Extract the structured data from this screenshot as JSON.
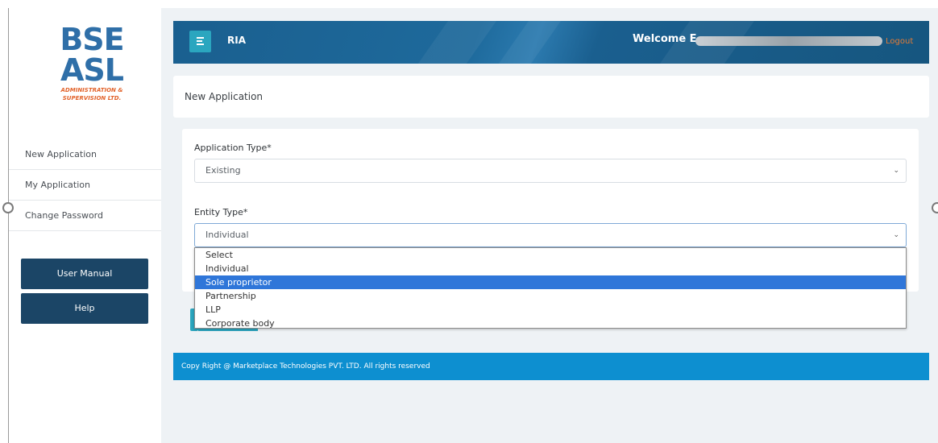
{
  "logo": {
    "line1": "BSE",
    "line2": "ASL",
    "subtitle_line1": "ADMINISTRATION &",
    "subtitle_line2": "SUPERVISION LTD."
  },
  "sidebar": {
    "items": [
      {
        "label": "New Application"
      },
      {
        "label": "My Application"
      },
      {
        "label": "Change Password"
      }
    ],
    "user_manual_label": "User Manual",
    "help_label": "Help"
  },
  "header": {
    "title": "RIA",
    "welcome": "Welcome E",
    "logout_label": "Logout"
  },
  "page": {
    "title": "New Application"
  },
  "form": {
    "application_type_label": "Application Type*",
    "application_type_value": "Existing",
    "entity_type_label": "Entity Type*",
    "entity_type_value": "Individual",
    "entity_options": [
      "Select",
      "Individual",
      "Sole proprietor",
      "Partnership",
      "LLP",
      "Corporate body"
    ],
    "highlighted_option": "Sole proprietor"
  },
  "footer": {
    "text": "Copy Right @ Marketplace Technologies PVT. LTD. All rights reserved"
  },
  "colors": {
    "brand_blue": "#2f6fa8",
    "brand_orange": "#e2632b",
    "header_bg": "#1a5f8f",
    "sidebar_button": "#1b4566",
    "accent_teal": "#2ba6bf",
    "footer_bg": "#0d8fd0",
    "option_highlight": "#2f76d9",
    "logout": "#e37b36"
  }
}
